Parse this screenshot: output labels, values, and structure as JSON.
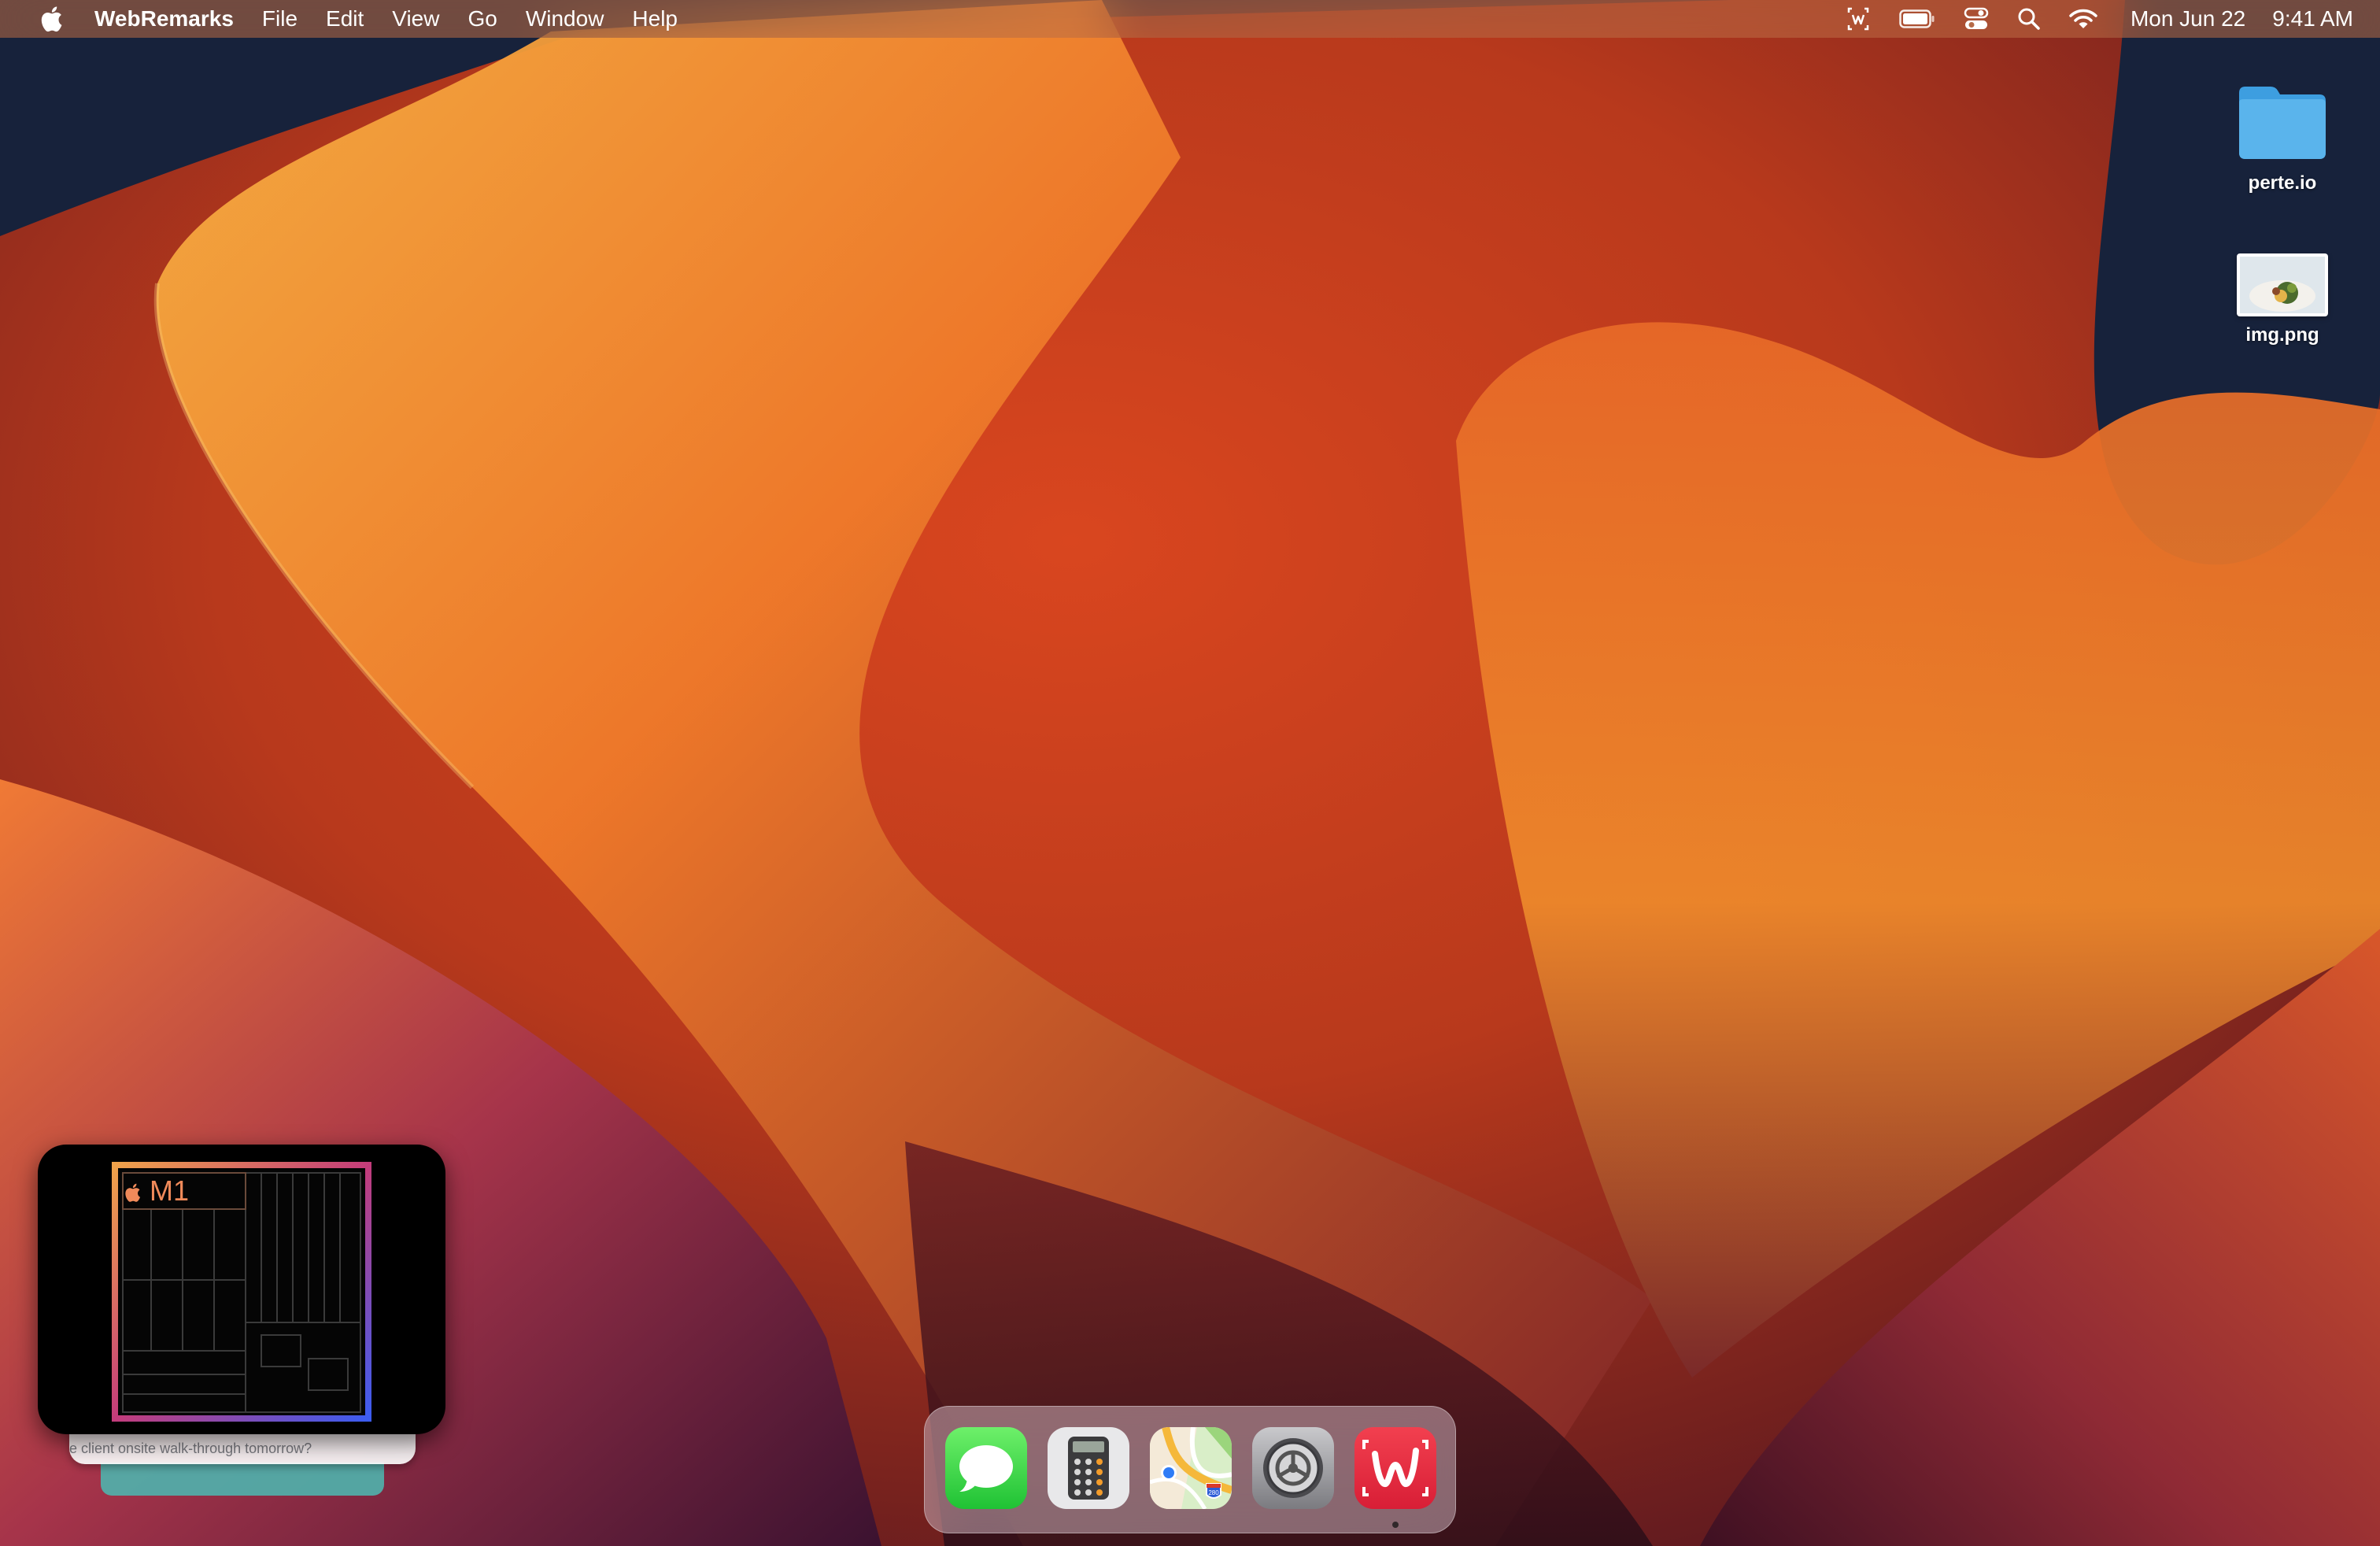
{
  "menubar": {
    "app_name": "WebRemarks",
    "menus": [
      "File",
      "Edit",
      "View",
      "Go",
      "Window",
      "Help"
    ],
    "status_icons": [
      "webremarks-status-icon",
      "battery-icon",
      "control-center-icon",
      "spotlight-search-icon",
      "wifi-icon"
    ],
    "date": "Mon Jun 22",
    "time": "9:41 AM"
  },
  "desktop_items": [
    {
      "label": "perte.io",
      "icon": "folder-icon"
    },
    {
      "label": "img.png",
      "icon": "image-thumbnail-icon"
    }
  ],
  "widget": {
    "chip_label": "M1",
    "notification_snippet": "e client onsite walk-through tomorrow?"
  },
  "dock": {
    "apps": [
      {
        "name": "Messages",
        "icon": "messages-icon",
        "running": false
      },
      {
        "name": "Calculator",
        "icon": "calculator-icon",
        "running": false
      },
      {
        "name": "Maps",
        "icon": "maps-icon",
        "running": false,
        "badge": "280"
      },
      {
        "name": "System Settings",
        "icon": "system-settings-icon",
        "running": false
      },
      {
        "name": "WebRemarks",
        "icon": "webremarks-icon",
        "running": true
      }
    ]
  },
  "colors": {
    "wallpaper_orange": "#e8712a",
    "wallpaper_dark": "#16213a",
    "wallpaper_purple": "#4a1a45",
    "folder_blue": "#5ab4ec",
    "webremarks_red": "#e5283c",
    "widget_teal": "#4fb3ad"
  }
}
